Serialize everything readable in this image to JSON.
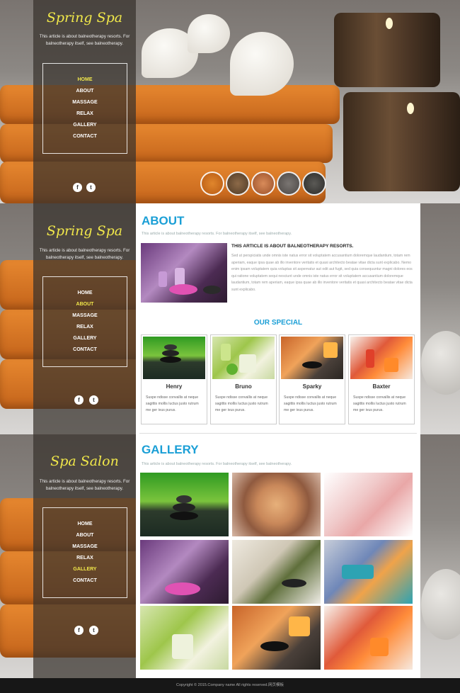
{
  "brand": {
    "accent": "#1b9fd6",
    "logo_color": "#f1e84a"
  },
  "hero": {
    "logo": "Spring Spa",
    "tagline": "This article is about balneotherapy resorts. For balneotherapy itself, see balneotherapy.",
    "nav": [
      "HOME",
      "ABOUT",
      "MASSAGE",
      "RELAX",
      "GALLERY",
      "CONTACT"
    ],
    "active": "HOME",
    "social": [
      "facebook-icon",
      "twitter-icon"
    ]
  },
  "about_section": {
    "logo": "Spring Spa",
    "tagline": "This article is about balneotherapy resorts. For balneotherapy itself, see balneotherapy.",
    "nav": [
      "HOME",
      "ABOUT",
      "MASSAGE",
      "RELAX",
      "GALLERY",
      "CONTACT"
    ],
    "active": "ABOUT",
    "heading": "ABOUT",
    "subtitle": "This article is about balneotherapy resorts. For balneotherapy itself, see balneotherapy.",
    "article_title": "THIS ARTICLE IS ABOUT BALNEOTHERAPY RESORTS.",
    "article_body": "Sed ut perspiciatis unde omnis iste natus error sit voluptatem accusantium doloremque laudantium, totam rem aperiam, eaque ipsa quae ab illo inventore veritatis et quasi architecto beatae vitae dicta sunt explicabo. Nemo enim ipsam voluptatem quia voluptas sit aspernatur aut odit aut fugit, sed quia consequuntur magni dolores eos qui ratione voluptatem sequi nesciunt unde omnis iste natus error sit voluptatem accusantium doloremque laudantium, totam rem aperiam, eaque ipsa quae ab illo inventore veritatis et quasi architecto beatae vitae dicta sunt explicabo.",
    "special_heading": "OUR SPECIAL",
    "specials": [
      {
        "name": "Henry",
        "desc": "Suspe ndisse convallis at neque sagittis mollis luctus justo rutrum me ger ivus purus."
      },
      {
        "name": "Bruno",
        "desc": "Suspe ndisse convallis at neque sagittis mollis luctus justo rutrum me ger ivus purus."
      },
      {
        "name": "Sparky",
        "desc": "Suspe ndisse convallis at neque sagittis mollis luctus justo rutrum me ger ivus purus."
      },
      {
        "name": "Baxter",
        "desc": "Suspe ndisse convallis at neque sagittis mollis luctus justo rutrum me ger ivus purus."
      }
    ]
  },
  "gallery_section": {
    "logo": "Spa Salon",
    "tagline": "This article is about balneotherapy resorts. For balneotherapy itself, see balneotherapy.",
    "nav": [
      "HOME",
      "ABOUT",
      "MASSAGE",
      "RELAX",
      "GALLERY",
      "CONTACT"
    ],
    "active": "GALLERY",
    "heading": "GALLERY",
    "subtitle": "This article is about balneotherapy resorts. For balneotherapy itself, see balneotherapy."
  },
  "footer": {
    "text": "Copyright © 2015.Company name All rights reserved.网页模板"
  }
}
